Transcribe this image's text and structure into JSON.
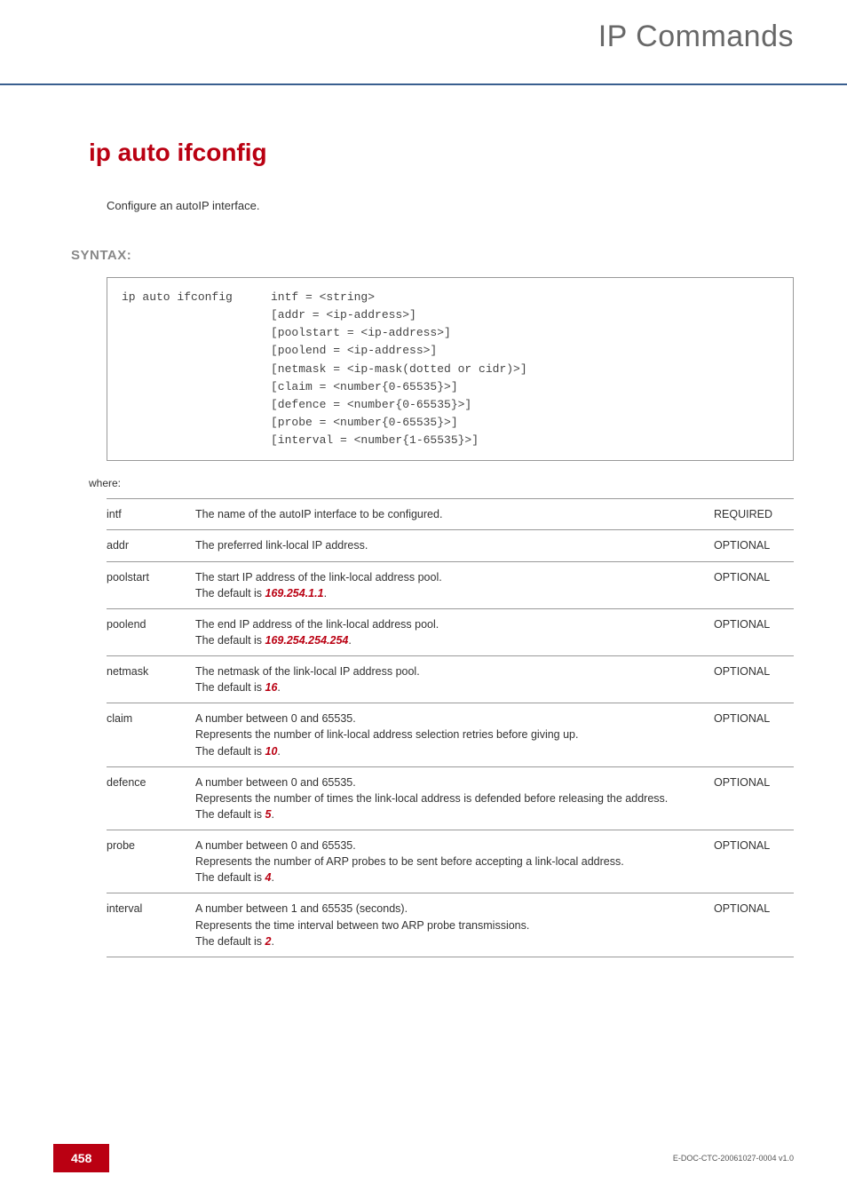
{
  "header": {
    "title": "IP Commands"
  },
  "section": {
    "title": "ip auto ifconfig",
    "description": "Configure an autoIP interface.",
    "syntax_label": "SYNTAX:",
    "where_label": "where:"
  },
  "code": {
    "command": "ip auto ifconfig",
    "args": "intf = <string>\n[addr = <ip-address>]\n[poolstart = <ip-address>]\n[poolend = <ip-address>]\n[netmask = <ip-mask(dotted or cidr)>]\n[claim = <number{0-65535}>]\n[defence = <number{0-65535}>]\n[probe = <number{0-65535}>]\n[interval = <number{1-65535}>]"
  },
  "params": [
    {
      "name": "intf",
      "desc_pre": "The name of the autoIP interface to be configured.",
      "hl": "",
      "desc_post": "",
      "req": "REQUIRED"
    },
    {
      "name": "addr",
      "desc_pre": "The preferred link-local IP address.",
      "hl": "",
      "desc_post": "",
      "req": "OPTIONAL"
    },
    {
      "name": "poolstart",
      "desc_pre": "The start IP address of the link-local address pool.\nThe default is ",
      "hl": "169.254.1.1",
      "desc_post": ".",
      "req": "OPTIONAL"
    },
    {
      "name": "poolend",
      "desc_pre": "The end IP address of the link-local address pool.\nThe default is ",
      "hl": "169.254.254.254",
      "desc_post": ".",
      "req": "OPTIONAL"
    },
    {
      "name": "netmask",
      "desc_pre": "The netmask of the link-local IP address pool.\nThe default is ",
      "hl": "16",
      "desc_post": ".",
      "req": "OPTIONAL"
    },
    {
      "name": "claim",
      "desc_pre": "A number between 0 and 65535.\nRepresents the number of link-local address selection retries before giving up.\nThe default is ",
      "hl": "10",
      "desc_post": ".",
      "req": "OPTIONAL"
    },
    {
      "name": "defence",
      "desc_pre": "A number between 0 and 65535.\nRepresents the number of times the link-local address is defended before releasing the address.\nThe default is ",
      "hl": "5",
      "desc_post": ".",
      "req": "OPTIONAL"
    },
    {
      "name": "probe",
      "desc_pre": "A number between 0 and 65535.\nRepresents the number of ARP probes to be sent before accepting a link-local address.\nThe default is ",
      "hl": "4",
      "desc_post": ".",
      "req": "OPTIONAL"
    },
    {
      "name": "interval",
      "desc_pre": "A number between 1 and 65535 (seconds).\nRepresents the time interval between two ARP probe transmissions.\nThe default is ",
      "hl": "2",
      "desc_post": ".",
      "req": "OPTIONAL"
    }
  ],
  "footer": {
    "page": "458",
    "docid": "E-DOC-CTC-20061027-0004 v1.0"
  }
}
